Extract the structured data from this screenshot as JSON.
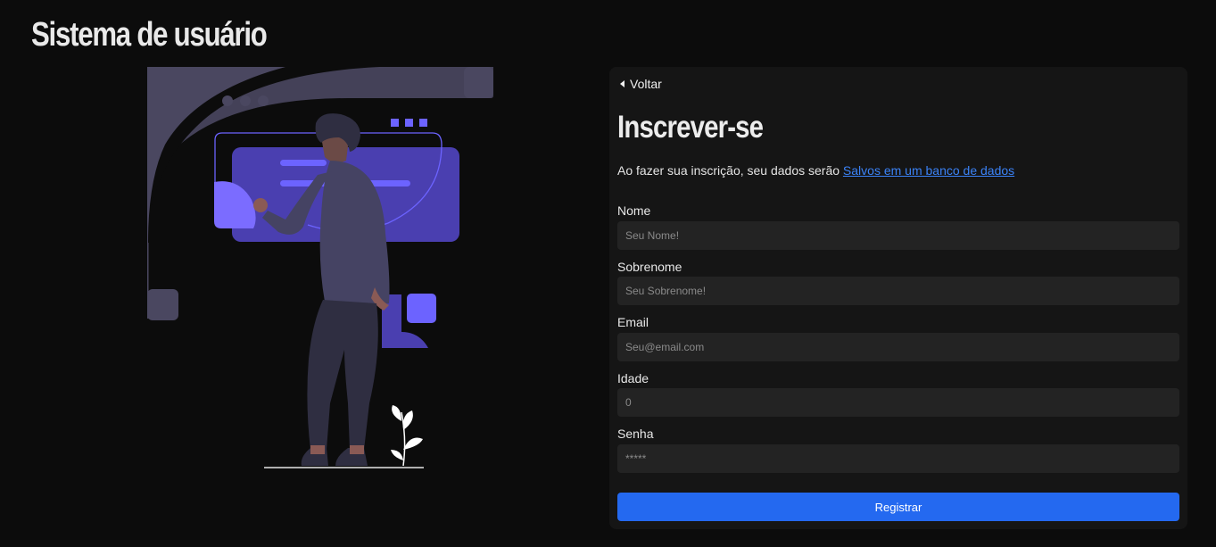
{
  "app": {
    "title": "Sistema de usuário"
  },
  "illustration": {
    "name": "person-using-interface-illustration"
  },
  "form": {
    "back_label": "Voltar",
    "title": "Inscrever-se",
    "intro_text": "Ao fazer sua inscrição, seu dados serão ",
    "intro_link": "Salvos em um banco de dados",
    "fields": [
      {
        "label": "Nome",
        "placeholder": "Seu Nome!"
      },
      {
        "label": "Sobrenome",
        "placeholder": "Seu Sobrenome!"
      },
      {
        "label": "Email",
        "placeholder": "Seu@email.com"
      },
      {
        "label": "Idade",
        "placeholder": "0"
      },
      {
        "label": "Senha",
        "placeholder": "*****"
      }
    ],
    "submit_label": "Registrar"
  },
  "colors": {
    "background": "#0c0c0c",
    "panel": "#151515",
    "input": "#232323",
    "accent": "#2469f0",
    "link": "#3b82f6",
    "illustration_purple": "#6c63ff",
    "illustration_dark": "#3f3d56"
  }
}
